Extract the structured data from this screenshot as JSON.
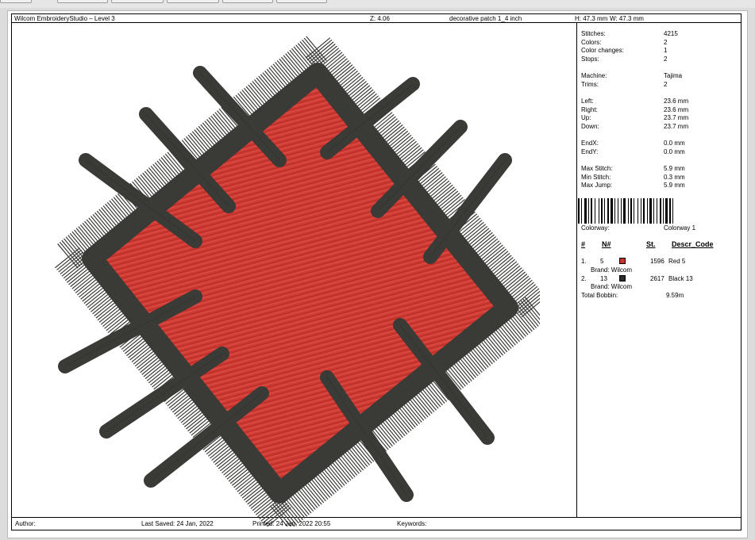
{
  "toolbar": {
    "buttons": [
      "",
      "",
      "",
      "",
      "",
      ""
    ]
  },
  "header": {
    "app_title": "Wilcom EmbroideryStudio – Level 3",
    "zoom": "Z: 4.06",
    "design_name": "decorative patch 1_4 inch",
    "height": "H: 47.3 mm",
    "width": "W: 47.3 mm"
  },
  "stats": {
    "stitches_label": "Stitches:",
    "stitches": "4215",
    "colors_label": "Colors:",
    "colors": "2",
    "color_changes_label": "Color changes:",
    "color_changes": "1",
    "stops_label": "Stops:",
    "stops": "2",
    "machine_label": "Machine:",
    "machine": "Tajima",
    "trims_label": "Trims:",
    "trims": "2",
    "left_label": "Left:",
    "left": "23.6 mm",
    "right_label": "Right:",
    "right": "23.6 mm",
    "up_label": "Up:",
    "up": "23.7 mm",
    "down_label": "Down:",
    "down": "23.7 mm",
    "endx_label": "EndX:",
    "endx": "0.0 mm",
    "endy_label": "EndY:",
    "endy": "0.0 mm",
    "max_stitch_label": "Max Stitch:",
    "max_stitch": "5.9 mm",
    "min_stitch_label": "Min Stitch:",
    "min_stitch": "0.3 mm",
    "max_jump_label": "Max Jump:",
    "max_jump": "5.9 mm"
  },
  "colorway": {
    "label": "Colorway:",
    "value": "Colorway 1"
  },
  "color_table": {
    "headers": {
      "num": "#",
      "n": "N#",
      "st": "St.",
      "descr": "Descr_Code"
    },
    "rows": [
      {
        "index": "1.",
        "n": "5",
        "color": "#c8302c",
        "stitches": "1596",
        "descr": "Red 5",
        "brand": "Brand: Wilcom"
      },
      {
        "index": "2.",
        "n": "13",
        "color": "#2b2b2b",
        "stitches": "2617",
        "descr": "Black 13",
        "brand": "Brand: Wilcom"
      }
    ],
    "total_bobbin_label": "Total Bobbin:",
    "total_bobbin": "9.59m"
  },
  "footer": {
    "author_label": "Author:",
    "last_saved": "Last Saved: 24 Jan, 2022",
    "printed": "Printed: 24 Jan, 2022 20:55",
    "keywords_label": "Keywords:"
  },
  "design": {
    "fill_color": "#cf3a33",
    "outline_color": "#3a3a37"
  }
}
